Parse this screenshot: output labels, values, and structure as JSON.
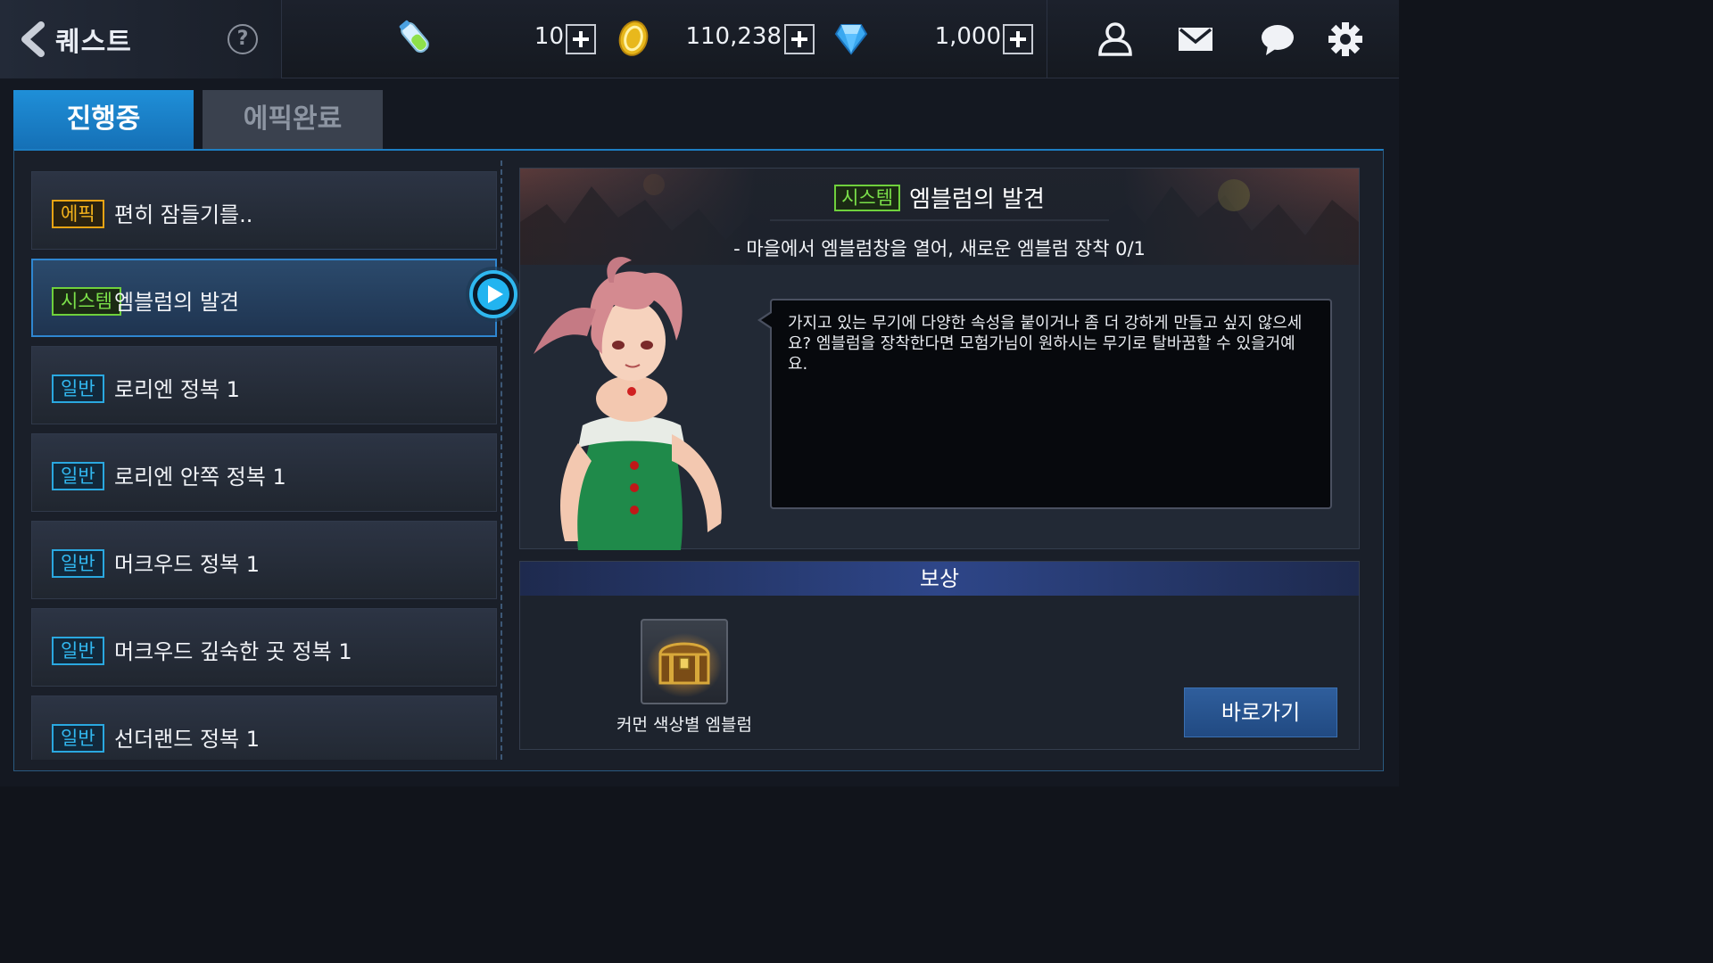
{
  "header": {
    "title": "퀘스트",
    "help_label": "?",
    "stamina_value": "10",
    "gold_value": "110,238",
    "gem_value": "1,000",
    "icons": [
      "back-arrow-icon",
      "help-icon",
      "stamina-potion-icon",
      "gold-coin-icon",
      "blue-gem-icon",
      "friends-icon",
      "mail-icon",
      "chat-icon",
      "settings-icon"
    ]
  },
  "tabs": [
    {
      "label": "진행중",
      "active": true
    },
    {
      "label": "에픽완료",
      "active": false
    }
  ],
  "quests": [
    {
      "type": "에픽",
      "name": "편히 잠들기를..",
      "selected": false
    },
    {
      "type": "시스템",
      "name": "엠블럼의 발견",
      "selected": true
    },
    {
      "type": "일반",
      "name": "로리엔 정복 1",
      "selected": false
    },
    {
      "type": "일반",
      "name": "로리엔 안쪽 정복 1",
      "selected": false
    },
    {
      "type": "일반",
      "name": "머크우드 정복 1",
      "selected": false
    },
    {
      "type": "일반",
      "name": "머크우드 깊숙한 곳 정복 1",
      "selected": false
    },
    {
      "type": "일반",
      "name": "선더랜드 정복 1",
      "selected": false
    }
  ],
  "detail": {
    "type": "시스템",
    "title": "엠블럼의 발견",
    "objective": "- 마을에서 엠블럼창을 열어, 새로운 엠블럼 장착 0/1",
    "dialogue": "가지고 있는 무기에 다양한 속성을 붙이거나 좀 더 강하게 만들고 싶지 않으세요?  엠블럼을 장착한다면 모험가님이 원하시는 무기로 탈바꿈할 수 있을거예요."
  },
  "reward": {
    "header": "보상",
    "item_label": "커먼 색상별 엠블럼",
    "item_icon": "treasure-chest-icon",
    "goto_label": "바로가기"
  },
  "colors": {
    "tab_active": "#1a82c8",
    "badge_epic": "#f3b21c",
    "badge_system": "#7be04a",
    "badge_normal": "#32b8f0",
    "selected_border": "#2f86d0"
  }
}
